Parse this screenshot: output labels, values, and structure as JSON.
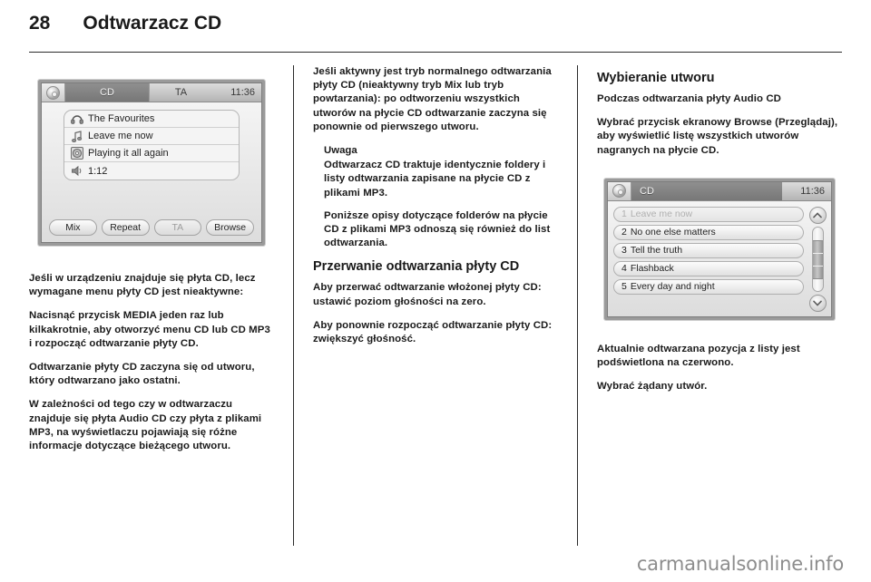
{
  "header": {
    "page_number": "28",
    "title": "Odtwarzacz CD"
  },
  "figure_cd_now_playing": {
    "titlebar": {
      "disc_icon": "cd-disc-icon",
      "source_label": "CD",
      "ta_label": "TA",
      "clock": "11:36"
    },
    "rows": [
      {
        "icon": "headphones-icon",
        "text": "The Favourites"
      },
      {
        "icon": "music-note-icon",
        "text": "Leave me now"
      },
      {
        "icon": "cd-disc-icon",
        "text": "Playing it all again"
      },
      {
        "icon": "speaker-icon",
        "text": "1:12"
      }
    ],
    "softkeys": [
      {
        "label": "Mix",
        "dim": false
      },
      {
        "label": "Repeat",
        "dim": false
      },
      {
        "label": "TA",
        "dim": true
      },
      {
        "label": "Browse",
        "dim": false
      }
    ]
  },
  "figure_cd_tracklist": {
    "titlebar": {
      "disc_icon": "cd-disc-icon",
      "source_label": "CD",
      "clock": "11:36"
    },
    "tracks": [
      {
        "number": "1",
        "title": "Leave me now",
        "playing": true
      },
      {
        "number": "2",
        "title": "No one else matters",
        "playing": false
      },
      {
        "number": "3",
        "title": "Tell the truth",
        "playing": false
      },
      {
        "number": "4",
        "title": "Flashback",
        "playing": false
      },
      {
        "number": "5",
        "title": "Every day and night",
        "playing": false
      }
    ],
    "scrollbar": {
      "up_icon": "chevron-up-icon",
      "down_icon": "chevron-down-icon"
    }
  },
  "column_left": {
    "paragraphs": [
      "Jeśli w urządzeniu znajduje się płyta CD, lecz wymagane menu płyty CD jest nieaktywne:",
      "Nacisnąć przycisk MEDIA jeden raz lub kilkakrotnie, aby otworzyć menu CD lub CD MP3 i rozpocząć odtwarzanie płyty CD.",
      "Odtwarzanie płyty CD zaczyna się od utworu, który odtwarzano jako ostatni.",
      "W zależności od tego czy w odtwarzaczu znajduje się płyta Audio CD czy płyta z plikami MP3, na wyświetlaczu pojawiają się różne informacje dotyczące bieżącego utworu."
    ]
  },
  "column_middle": {
    "intro": "Jeśli aktywny jest tryb normalnego odtwarzania płyty CD (nieaktywny tryb Mix lub tryb powtarzania): po odtworzeniu wszystkich utworów na płycie CD odtwarzanie zaczyna się ponownie od pierwszego utworu.",
    "note": {
      "title": "Uwaga",
      "paragraphs": [
        "Odtwarzacz CD traktuje identycznie foldery i listy odtwarzania zapisane na płycie CD z plikami MP3.",
        "Poniższe opisy dotyczące folderów na płycie CD z plikami MP3 odnoszą się również do list odtwarzania."
      ]
    },
    "section_title": "Przerwanie odtwarzania płyty CD",
    "paragraphs": [
      "Aby przerwać odtwarzanie włożonej płyty CD: ustawić poziom głośności na zero.",
      "Aby ponownie rozpocząć odtwarzanie płyty CD: zwiększyć głośność."
    ]
  },
  "column_right": {
    "section_title": "Wybieranie utworu",
    "subtitle": "Podczas odtwarzania płyty Audio CD",
    "paragraph_before": "Wybrać przycisk ekranowy Browse (Przeglądaj), aby wyświetlić listę wszystkich utworów nagranych na płycie CD.",
    "paragraphs_after": [
      "Aktualnie odtwarzana pozycja z listy jest podświetlona na czerwono.",
      "Wybrać żądany utwór."
    ]
  },
  "watermark": "carmanualsonline.info"
}
